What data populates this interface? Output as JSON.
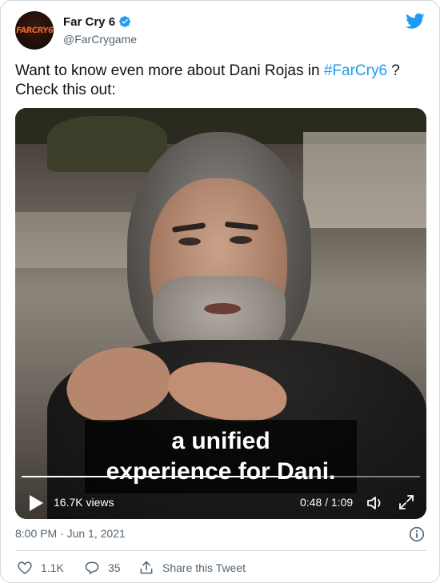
{
  "account": {
    "display_name": "Far Cry 6",
    "handle": "@FarCrygame",
    "avatar_text": "FARCRY6",
    "verified": true,
    "avatar_icon": "far-cry-6-logo"
  },
  "tweet": {
    "text_before": "Want to know even more about Dani Rojas in ",
    "hashtag": "#FarCry6",
    "text_after": " ? Check this out:"
  },
  "video": {
    "caption_line1": "a unified",
    "caption_line2": "experience for Dani.",
    "views": "16.7K views",
    "time": "0:48 / 1:09",
    "progress": 0.7
  },
  "meta": {
    "timestamp": "8:00 PM · Jun 1, 2021"
  },
  "actions": {
    "likes": "1.1K",
    "replies": "35",
    "share_label": "Share this Tweet"
  },
  "colors": {
    "accent": "#1d9bf0",
    "secondary_text": "#536471",
    "primary_text": "#0f1419",
    "border": "#cfd9de"
  }
}
